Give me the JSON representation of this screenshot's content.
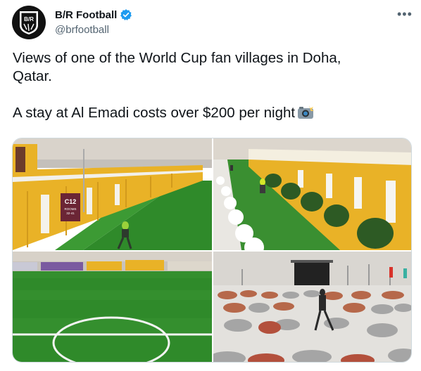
{
  "author": {
    "display_name": "B/R Football",
    "handle": "@brfootball",
    "avatar_text": "B/R",
    "verified": true
  },
  "tweet": {
    "text": "Views of one of the World Cup fan villages in Doha,\nQatar.\n\nA stay at Al Emadi costs over $200 per night",
    "emoji_icon": "camera-flash-icon"
  },
  "photos": {
    "p1_sign_code": "C12",
    "p1_sign_sub": "ROOMS",
    "p1_sign_nums": "32-41"
  },
  "colors": {
    "accent": "#1d9bf0",
    "container_yellow": "#e9b227",
    "grass": "#2f8a2a"
  },
  "icons": {
    "more": "more-options-icon",
    "verified": "verified-badge-icon"
  }
}
